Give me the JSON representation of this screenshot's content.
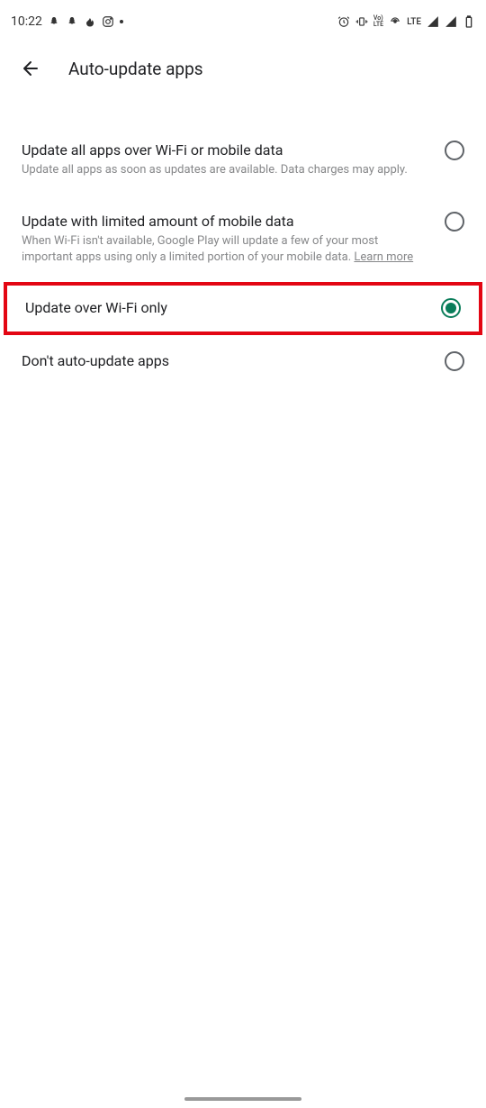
{
  "statusBar": {
    "time": "10:22",
    "lte": "LTE",
    "volte": "Vo)\nLTE"
  },
  "header": {
    "title": "Auto-update apps"
  },
  "options": [
    {
      "title": "Update all apps over Wi-Fi or mobile data",
      "description": "Update all apps as soon as updates are available. Data charges may apply.",
      "selected": false,
      "highlighted": false
    },
    {
      "title": "Update with limited amount of mobile data",
      "description": "When Wi-Fi isn't available, Google Play will update a few of your most important apps using only a limited portion of your mobile data.",
      "learnMore": "Learn more",
      "selected": false,
      "highlighted": false
    },
    {
      "title": "Update over Wi-Fi only",
      "selected": true,
      "highlighted": true
    },
    {
      "title": "Don't auto-update apps",
      "selected": false,
      "highlighted": false
    }
  ]
}
